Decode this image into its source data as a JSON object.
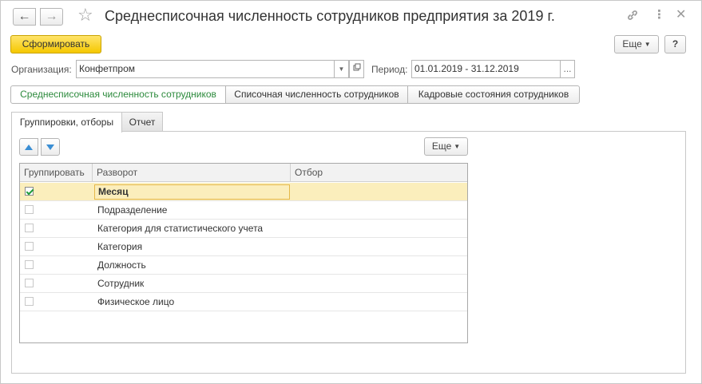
{
  "header": {
    "back_icon": "←",
    "forward_icon": "→",
    "favorite_icon": "☆",
    "title": "Среднесписочная численность сотрудников предприятия за 2019 г.",
    "link_icon": "🔗",
    "more_icon": "⋮",
    "close_icon": "✕"
  },
  "toolbar": {
    "generate_label": "Сформировать",
    "more_label": "Еще",
    "help_label": "?"
  },
  "filters": {
    "organization_label": "Организация:",
    "organization_value": "Конфетпром",
    "period_label": "Период:",
    "period_value": "01.01.2019 - 31.12.2019",
    "period_select": "..."
  },
  "variants": [
    {
      "label": "Среднесписочная численность сотрудников"
    },
    {
      "label": "Списочная численность сотрудников"
    },
    {
      "label": "Кадровые состояния сотрудников"
    }
  ],
  "tabs": [
    {
      "label": "Группировки, отборы"
    },
    {
      "label": "Отчет"
    }
  ],
  "panel": {
    "more_label": "Еще"
  },
  "grid": {
    "columns": [
      "Группировать",
      "Разворот",
      "Отбор"
    ],
    "rows": [
      {
        "checked": true,
        "name": "Месяц",
        "filter": ""
      },
      {
        "checked": false,
        "name": "Подразделение",
        "filter": ""
      },
      {
        "checked": false,
        "name": "Категория для статистического учета",
        "filter": ""
      },
      {
        "checked": false,
        "name": "Категория",
        "filter": ""
      },
      {
        "checked": false,
        "name": "Должность",
        "filter": ""
      },
      {
        "checked": false,
        "name": "Сотрудник",
        "filter": ""
      },
      {
        "checked": false,
        "name": "Физическое лицо",
        "filter": ""
      }
    ]
  },
  "colors": {
    "accent_button": "#f5c800",
    "active_variant_text": "#2c8a3c",
    "selected_row": "#fbeebc",
    "arrow_blue": "#3a8ed4"
  }
}
